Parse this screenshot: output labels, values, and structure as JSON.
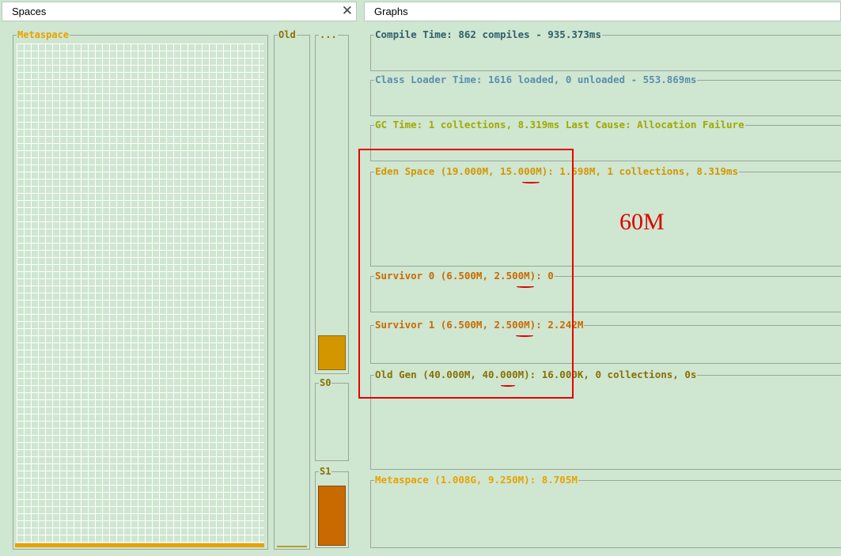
{
  "tabs": {
    "spaces": {
      "label": "Spaces",
      "close": "✕"
    },
    "graphs": {
      "label": "Graphs"
    }
  },
  "spaces": {
    "metaspace": {
      "label": "Metaspace",
      "color": "#e8a200"
    },
    "old": {
      "label": "Old"
    },
    "eden": {
      "label": "...",
      "color": "#d49600"
    },
    "s0": {
      "label": "S0"
    },
    "s1": {
      "label": "S1",
      "color": "#c86a00"
    }
  },
  "graphs": {
    "compile": {
      "label": "Compile Time: 862 compiles - 935.373ms",
      "color": "#2f5f6a"
    },
    "classloader": {
      "label": "Class Loader Time: 1616 loaded, 0 unloaded - 553.869ms",
      "color": "#5a8fae"
    },
    "gc": {
      "label": "GC Time: 1 collections, 8.319ms Last Cause: Allocation Failure",
      "color": "#a2a800"
    },
    "eden": {
      "label": "Eden Space (19.000M, 15.000M): 1.598M, 1 collections, 8.319ms",
      "color": "#d49600"
    },
    "survivor0": {
      "label": "Survivor 0 (6.500M, 2.500M): 0",
      "color": "#c86a00"
    },
    "survivor1": {
      "label": "Survivor 1 (6.500M, 2.500M): 2.242M",
      "color": "#c86a00"
    },
    "oldgen": {
      "label": "Old Gen (40.000M, 40.000M): 16.000K, 0 collections, 0s",
      "color": "#8a7000"
    },
    "metaspace": {
      "label": "Metaspace (1.008G, 9.250M): 8.705M",
      "color": "#e8a200"
    }
  },
  "annotation": {
    "text": "60M",
    "color": "#e00000"
  }
}
